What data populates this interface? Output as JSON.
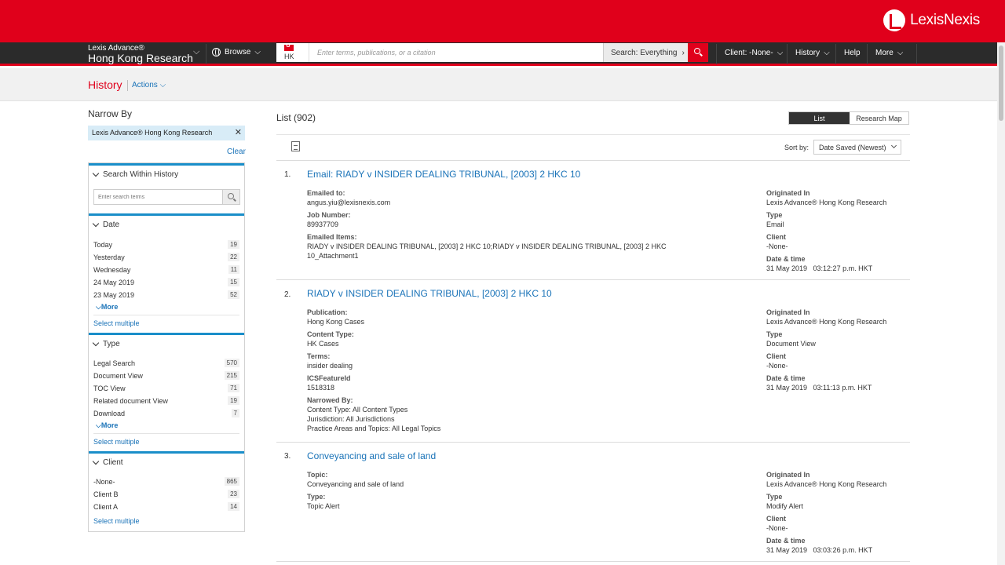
{
  "brand": {
    "logo_text": "LexisNexis",
    "product_small": "Lexis Advance®",
    "product_big": "Hong Kong Research"
  },
  "nav": {
    "browse": "Browse",
    "jurisdiction": "HK",
    "search_placeholder": "Enter terms, publications, or a citation",
    "search_scope": "Search: Everything",
    "client": "Client: -None-",
    "history": "History",
    "help": "Help",
    "more": "More"
  },
  "subheader": {
    "title": "History",
    "actions": "Actions"
  },
  "sidebar": {
    "title": "Narrow By",
    "chip": "Lexis Advance® Hong Kong Research",
    "clear": "Clear",
    "search_within": {
      "label": "Search Within History",
      "placeholder": "Enter search terms"
    },
    "date": {
      "label": "Date",
      "items": [
        {
          "label": "Today",
          "count": "19"
        },
        {
          "label": "Yesterday",
          "count": "22"
        },
        {
          "label": "Wednesday",
          "count": "11"
        },
        {
          "label": "24 May 2019",
          "count": "15"
        },
        {
          "label": "23 May 2019",
          "count": "52"
        }
      ],
      "more": "More",
      "select_multiple": "Select multiple"
    },
    "type": {
      "label": "Type",
      "items": [
        {
          "label": "Legal Search",
          "count": "570"
        },
        {
          "label": "Document View",
          "count": "215"
        },
        {
          "label": "TOC View",
          "count": "71"
        },
        {
          "label": "Related document View",
          "count": "19"
        },
        {
          "label": "Download",
          "count": "7"
        }
      ],
      "more": "More",
      "select_multiple": "Select multiple"
    },
    "client": {
      "label": "Client",
      "items": [
        {
          "label": "-None-",
          "count": "865"
        },
        {
          "label": "Client B",
          "count": "23"
        },
        {
          "label": "Client A",
          "count": "14"
        }
      ],
      "select_multiple": "Select multiple"
    }
  },
  "main": {
    "list_title": "List (902)",
    "view_list": "List",
    "view_map": "Research Map",
    "sort_label": "Sort by:",
    "sort_value": "Date Saved (Newest)",
    "items": [
      {
        "num": "1.",
        "title": "Email: RIADY v INSIDER DEALING TRIBUNAL, [2003] 2 HKC 10",
        "left": [
          {
            "label": "Emailed to:",
            "values": [
              "angus.yiu@lexisnexis.com"
            ]
          },
          {
            "label": "Job Number:",
            "values": [
              "89937709"
            ]
          },
          {
            "label": "Emailed Items:",
            "values": [
              "RIADY v INSIDER DEALING TRIBUNAL, [2003] 2 HKC 10;RIADY v INSIDER DEALING TRIBUNAL, [2003] 2 HKC",
              "10_Attachment1"
            ]
          }
        ],
        "right": [
          {
            "label": "Originated In",
            "value": "Lexis Advance® Hong Kong Research"
          },
          {
            "label": "Type",
            "value": "Email"
          },
          {
            "label": "Client",
            "value": "-None-"
          },
          {
            "label": "Date & time",
            "value": "31 May 2019   03:12:27 p.m. HKT"
          }
        ]
      },
      {
        "num": "2.",
        "title": "RIADY v INSIDER DEALING TRIBUNAL, [2003] 2 HKC 10",
        "left": [
          {
            "label": "Publication:",
            "values": [
              "Hong Kong Cases"
            ]
          },
          {
            "label": "Content Type:",
            "values": [
              "HK Cases"
            ]
          },
          {
            "label": "Terms:",
            "values": [
              "insider dealing"
            ]
          },
          {
            "label": "ICSFeatureId",
            "values": [
              "1518318"
            ]
          },
          {
            "label": "Narrowed By:",
            "values": [
              "Content Type: All Content Types",
              "Jurisdiction: All Jurisdictions",
              "Practice Areas and Topics: All Legal Topics"
            ]
          }
        ],
        "right": [
          {
            "label": "Originated In",
            "value": "Lexis Advance® Hong Kong Research"
          },
          {
            "label": "Type",
            "value": "Document View"
          },
          {
            "label": "Client",
            "value": "-None-"
          },
          {
            "label": "Date & time",
            "value": "31 May 2019   03:11:13 p.m. HKT"
          }
        ]
      },
      {
        "num": "3.",
        "title": "Conveyancing and sale of land",
        "left": [
          {
            "label": "Topic:",
            "values": [
              "Conveyancing and sale of land"
            ]
          },
          {
            "label": "Type:",
            "values": [
              "Topic Alert"
            ]
          }
        ],
        "right": [
          {
            "label": "Originated In",
            "value": "Lexis Advance® Hong Kong Research"
          },
          {
            "label": "Type",
            "value": "Modify Alert"
          },
          {
            "label": "Client",
            "value": "-None-"
          },
          {
            "label": "Date & time",
            "value": "31 May 2019   03:03:26 p.m. HKT"
          }
        ]
      }
    ]
  }
}
